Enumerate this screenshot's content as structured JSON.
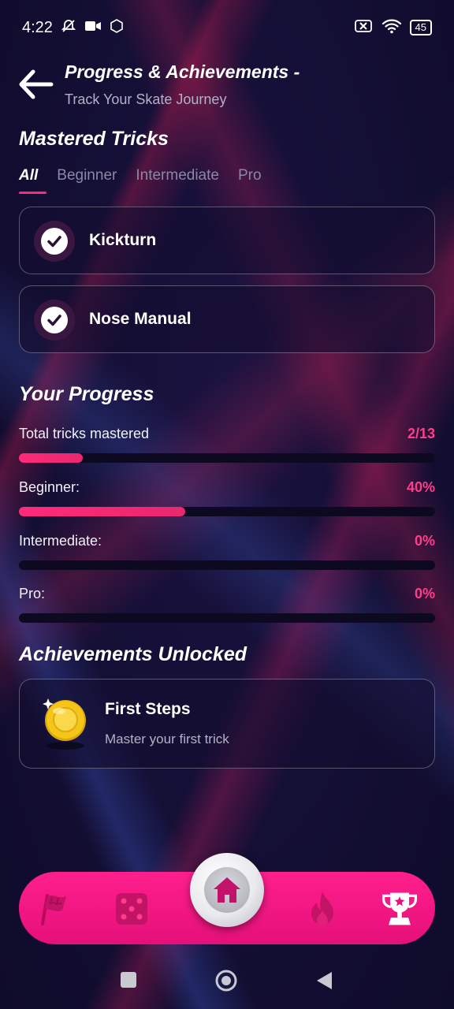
{
  "status_bar": {
    "time": "4:22",
    "battery": "45"
  },
  "header": {
    "title": "Progress & Achievements -",
    "subtitle": "Track Your Skate Journey"
  },
  "mastered": {
    "section_title": "Mastered Tricks",
    "tabs": [
      {
        "label": "All",
        "active": true
      },
      {
        "label": "Beginner",
        "active": false
      },
      {
        "label": "Intermediate",
        "active": false
      },
      {
        "label": "Pro",
        "active": false
      }
    ],
    "tricks": [
      {
        "label": "Kickturn"
      },
      {
        "label": "Nose Manual"
      }
    ]
  },
  "progress": {
    "section_title": "Your Progress",
    "rows": [
      {
        "label": "Total tricks mastered",
        "value": "2/13",
        "fraction": 0.154
      },
      {
        "label": "Beginner:",
        "value": "40%",
        "fraction": 0.4
      },
      {
        "label": "Intermediate:",
        "value": "0%",
        "fraction": 0
      },
      {
        "label": "Pro:",
        "value": "0%",
        "fraction": 0
      }
    ]
  },
  "achievements": {
    "section_title": "Achievements Unlocked",
    "items": [
      {
        "title": "First Steps",
        "description": "Master your first trick",
        "icon": "gold-coin-icon"
      }
    ]
  },
  "bottom_nav": {
    "items": [
      "flag-icon",
      "dice-icon",
      "home-icon",
      "fire-icon",
      "trophy-icon"
    ],
    "active": "home-icon"
  },
  "colors": {
    "accent": "#ff2a7a",
    "nav_bar": "#ff1f8c",
    "background": "#140f35"
  }
}
